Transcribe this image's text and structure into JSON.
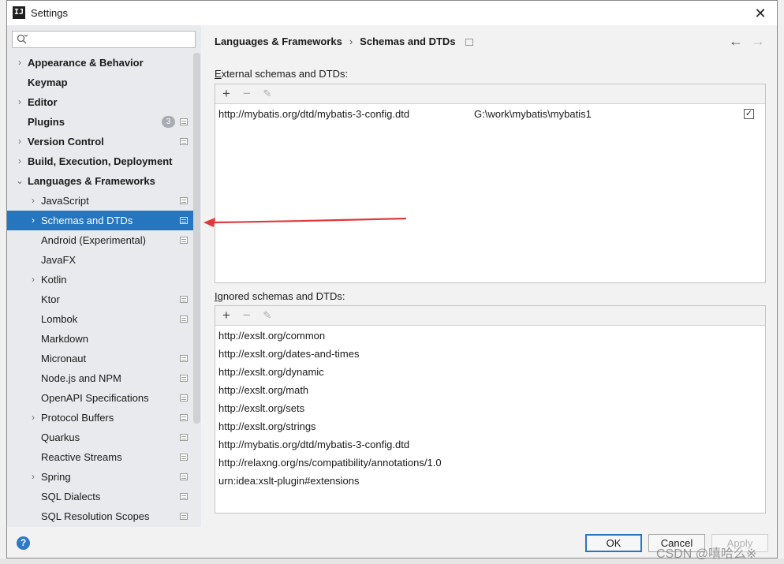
{
  "window": {
    "title": "Settings",
    "close_label": "✕",
    "app_icon_text": "IJ"
  },
  "sidebar": {
    "search": {
      "placeholder": "",
      "value": ""
    },
    "items": [
      {
        "label": "Appearance & Behavior",
        "arrow": "›",
        "level": 0,
        "bold": true,
        "selected": false,
        "gear": false
      },
      {
        "label": "Keymap",
        "arrow": "",
        "level": 0,
        "bold": true,
        "selected": false,
        "gear": false
      },
      {
        "label": "Editor",
        "arrow": "›",
        "level": 0,
        "bold": true,
        "selected": false,
        "gear": false
      },
      {
        "label": "Plugins",
        "arrow": "",
        "level": 0,
        "bold": true,
        "selected": false,
        "gear": true,
        "badge": "3"
      },
      {
        "label": "Version Control",
        "arrow": "›",
        "level": 0,
        "bold": true,
        "selected": false,
        "gear": true
      },
      {
        "label": "Build, Execution, Deployment",
        "arrow": "›",
        "level": 0,
        "bold": true,
        "selected": false,
        "gear": false
      },
      {
        "label": "Languages & Frameworks",
        "arrow": "⌄",
        "level": 0,
        "bold": true,
        "selected": false,
        "gear": false
      },
      {
        "label": "JavaScript",
        "arrow": "›",
        "level": 1,
        "bold": false,
        "selected": false,
        "gear": true
      },
      {
        "label": "Schemas and DTDs",
        "arrow": "›",
        "level": 1,
        "bold": false,
        "selected": true,
        "gear": true
      },
      {
        "label": "Android (Experimental)",
        "arrow": "",
        "level": 1,
        "bold": false,
        "selected": false,
        "gear": true
      },
      {
        "label": "JavaFX",
        "arrow": "",
        "level": 1,
        "bold": false,
        "selected": false,
        "gear": false
      },
      {
        "label": "Kotlin",
        "arrow": "›",
        "level": 1,
        "bold": false,
        "selected": false,
        "gear": false
      },
      {
        "label": "Ktor",
        "arrow": "",
        "level": 1,
        "bold": false,
        "selected": false,
        "gear": true
      },
      {
        "label": "Lombok",
        "arrow": "",
        "level": 1,
        "bold": false,
        "selected": false,
        "gear": true
      },
      {
        "label": "Markdown",
        "arrow": "",
        "level": 1,
        "bold": false,
        "selected": false,
        "gear": false
      },
      {
        "label": "Micronaut",
        "arrow": "",
        "level": 1,
        "bold": false,
        "selected": false,
        "gear": true
      },
      {
        "label": "Node.js and NPM",
        "arrow": "",
        "level": 1,
        "bold": false,
        "selected": false,
        "gear": true
      },
      {
        "label": "OpenAPI Specifications",
        "arrow": "",
        "level": 1,
        "bold": false,
        "selected": false,
        "gear": true
      },
      {
        "label": "Protocol Buffers",
        "arrow": "›",
        "level": 1,
        "bold": false,
        "selected": false,
        "gear": true
      },
      {
        "label": "Quarkus",
        "arrow": "",
        "level": 1,
        "bold": false,
        "selected": false,
        "gear": true
      },
      {
        "label": "Reactive Streams",
        "arrow": "",
        "level": 1,
        "bold": false,
        "selected": false,
        "gear": true
      },
      {
        "label": "Spring",
        "arrow": "›",
        "level": 1,
        "bold": false,
        "selected": false,
        "gear": true
      },
      {
        "label": "SQL Dialects",
        "arrow": "",
        "level": 1,
        "bold": false,
        "selected": false,
        "gear": true
      },
      {
        "label": "SQL Resolution Scopes",
        "arrow": "",
        "level": 1,
        "bold": false,
        "selected": false,
        "gear": true
      }
    ]
  },
  "main": {
    "breadcrumb": {
      "parent": "Languages & Frameworks",
      "separator": "›",
      "current": "Schemas and DTDs"
    },
    "nav": {
      "back": "←",
      "forward": "→"
    },
    "external": {
      "label_prefix": "E",
      "label_rest": "xternal schemas and DTDs:",
      "toolbar": {
        "add": "+",
        "remove": "−",
        "edit": "✎"
      },
      "rows": [
        {
          "uri": "http://mybatis.org/dtd/mybatis-3-config.dtd",
          "path": "G:\\work\\mybatis\\mybatis1",
          "checked": true,
          "check_mark": "✓"
        }
      ]
    },
    "ignored": {
      "label_prefix": "I",
      "label_rest": "gnored schemas and DTDs:",
      "toolbar": {
        "add": "+",
        "remove": "−",
        "edit": "✎"
      },
      "rows": [
        "http://exslt.org/common",
        "http://exslt.org/dates-and-times",
        "http://exslt.org/dynamic",
        "http://exslt.org/math",
        "http://exslt.org/sets",
        "http://exslt.org/strings",
        "http://mybatis.org/dtd/mybatis-3-config.dtd",
        "http://relaxng.org/ns/compatibility/annotations/1.0",
        "urn:idea:xslt-plugin#extensions"
      ]
    }
  },
  "footer": {
    "help": "?",
    "ok": "OK",
    "cancel": "Cancel",
    "apply": "Apply"
  },
  "watermark": "CSDN @嘻哈么※",
  "colors": {
    "selection": "#2675bf",
    "annotation_arrow": "#e0393c"
  }
}
